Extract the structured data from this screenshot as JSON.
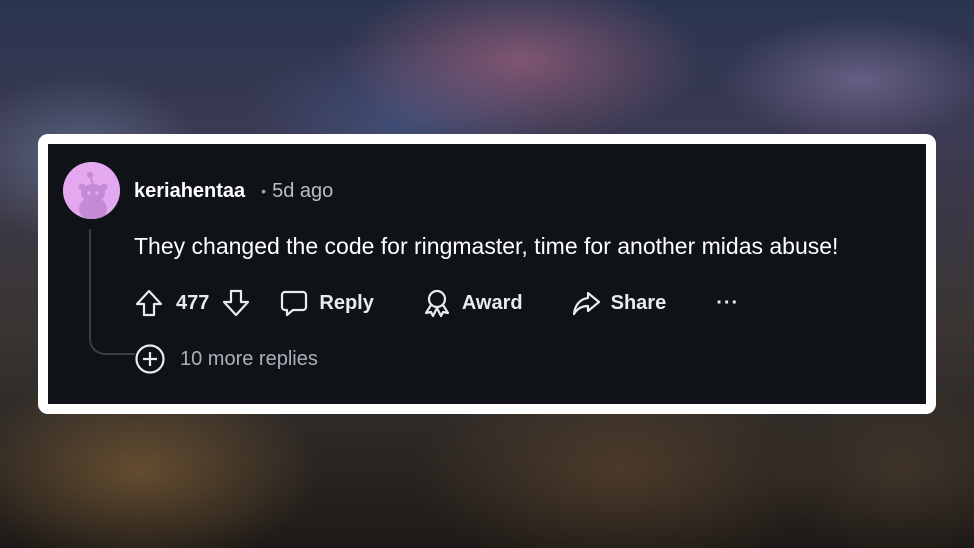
{
  "comment": {
    "username": "keriahentaa",
    "separator": "•",
    "time": "5d ago",
    "text": "They changed the code for ringmaster, time for another midas abuse!"
  },
  "actions": {
    "score": "477",
    "reply_label": "Reply",
    "award_label": "Award",
    "share_label": "Share",
    "more_label": "···"
  },
  "replies": {
    "more_label": "10 more replies"
  },
  "colors": {
    "avatar_bg": "#e3a8f0",
    "card_bg": "#0f1216",
    "frame": "#ffffff"
  },
  "icons": [
    "upvote-icon",
    "downvote-icon",
    "comment-icon",
    "award-icon",
    "share-icon",
    "expand-plus-icon"
  ]
}
